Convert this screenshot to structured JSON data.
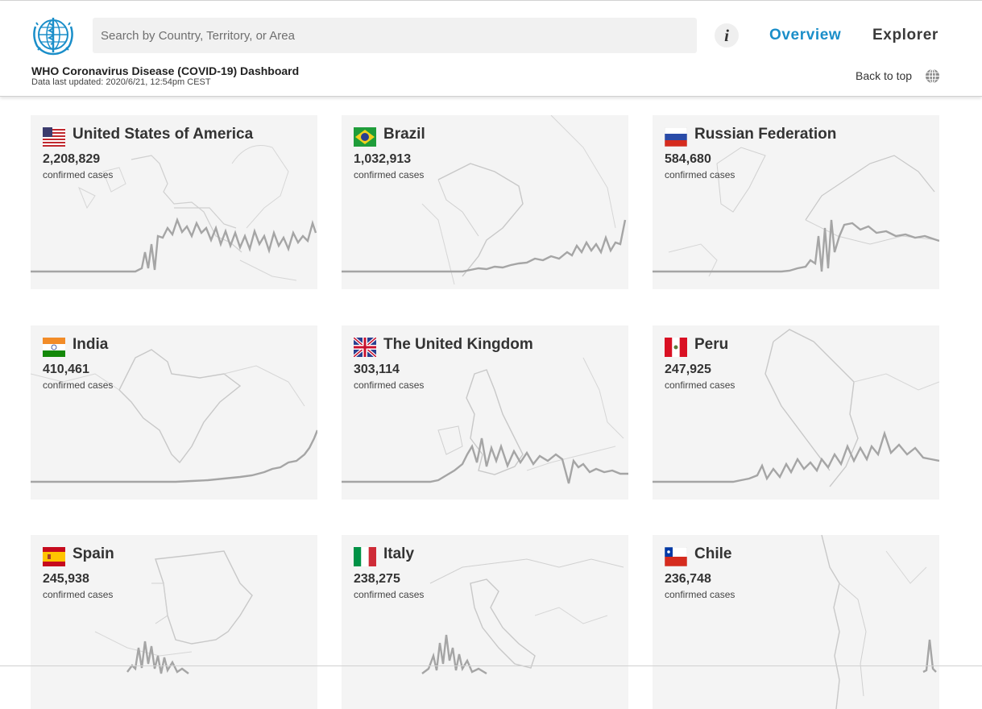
{
  "header": {
    "logo_icon": "who-emblem-icon",
    "search_placeholder": "Search by Country, Territory, or Area",
    "info_label": "i",
    "nav": {
      "overview": "Overview",
      "explorer": "Explorer"
    },
    "dashboard_title": "WHO Coronavirus Disease (COVID-19) Dashboard",
    "last_updated": "Data last updated: 2020/6/21, 12:54pm CEST",
    "back_to_top": "Back to top",
    "accent_color": "#1a8ec9"
  },
  "cards": [
    {
      "name": "United States of America",
      "count": "2,208,829",
      "label": "confirmed cases",
      "flag_icon": "usa-flag-icon"
    },
    {
      "name": "Brazil",
      "count": "1,032,913",
      "label": "confirmed cases",
      "flag_icon": "brazil-flag-icon"
    },
    {
      "name": "Russian Federation",
      "count": "584,680",
      "label": "confirmed cases",
      "flag_icon": "russia-flag-icon"
    },
    {
      "name": "India",
      "count": "410,461",
      "label": "confirmed cases",
      "flag_icon": "india-flag-icon"
    },
    {
      "name": "The United Kingdom",
      "count": "303,114",
      "label": "confirmed cases",
      "flag_icon": "uk-flag-icon"
    },
    {
      "name": "Peru",
      "count": "247,925",
      "label": "confirmed cases",
      "flag_icon": "peru-flag-icon"
    },
    {
      "name": "Spain",
      "count": "245,938",
      "label": "confirmed cases",
      "flag_icon": "spain-flag-icon"
    },
    {
      "name": "Italy",
      "count": "238,275",
      "label": "confirmed cases",
      "flag_icon": "italy-flag-icon"
    },
    {
      "name": "Chile",
      "count": "236,748",
      "label": "confirmed cases",
      "flag_icon": "chile-flag-icon"
    }
  ]
}
